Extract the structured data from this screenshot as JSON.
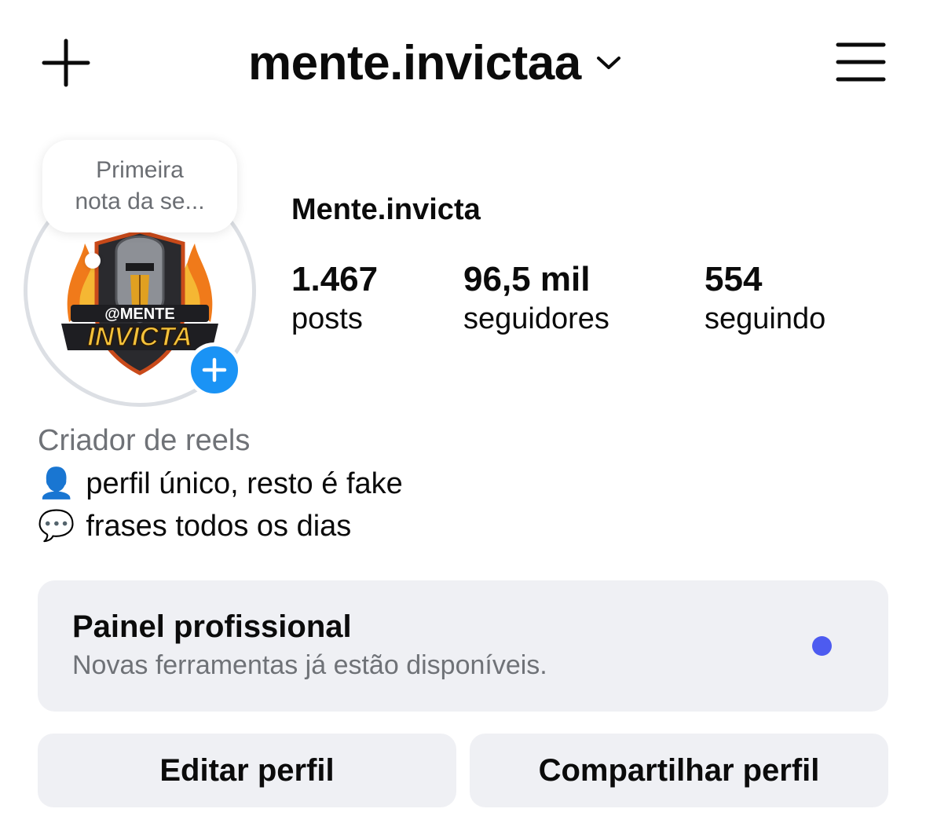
{
  "header": {
    "username": "mente.invictaa",
    "new_icon": "plus-icon",
    "switch_icon": "chevron-down-icon",
    "menu_icon": "hamburger-menu-icon"
  },
  "note": {
    "line1": "Primeira",
    "line2": "nota da se..."
  },
  "avatar": {
    "logo_top": "@MENTE",
    "logo_bottom": "INVICTA",
    "add_icon": "plus-icon"
  },
  "profile": {
    "display_name": "Mente.invicta",
    "stats": [
      {
        "value": "1.467",
        "label": "posts"
      },
      {
        "value": "96,5 mil",
        "label": "seguidores"
      },
      {
        "value": "554",
        "label": "seguindo"
      }
    ]
  },
  "bio": {
    "category": "Criador de reels",
    "lines": [
      {
        "emoji": "👤",
        "text": "perfil único, resto é fake"
      },
      {
        "emoji": "💬",
        "text": "frases todos os dias"
      }
    ]
  },
  "dashboard": {
    "title": "Painel profissional",
    "subtitle": "Novas ferramentas já estão disponíveis.",
    "dot_color": "#4d5bf0"
  },
  "actions": {
    "edit": "Editar perfil",
    "share": "Compartilhar perfil"
  },
  "colors": {
    "accent_blue": "#1a93f5",
    "card_bg": "#eff0f4",
    "secondary_text": "#6f7277"
  }
}
